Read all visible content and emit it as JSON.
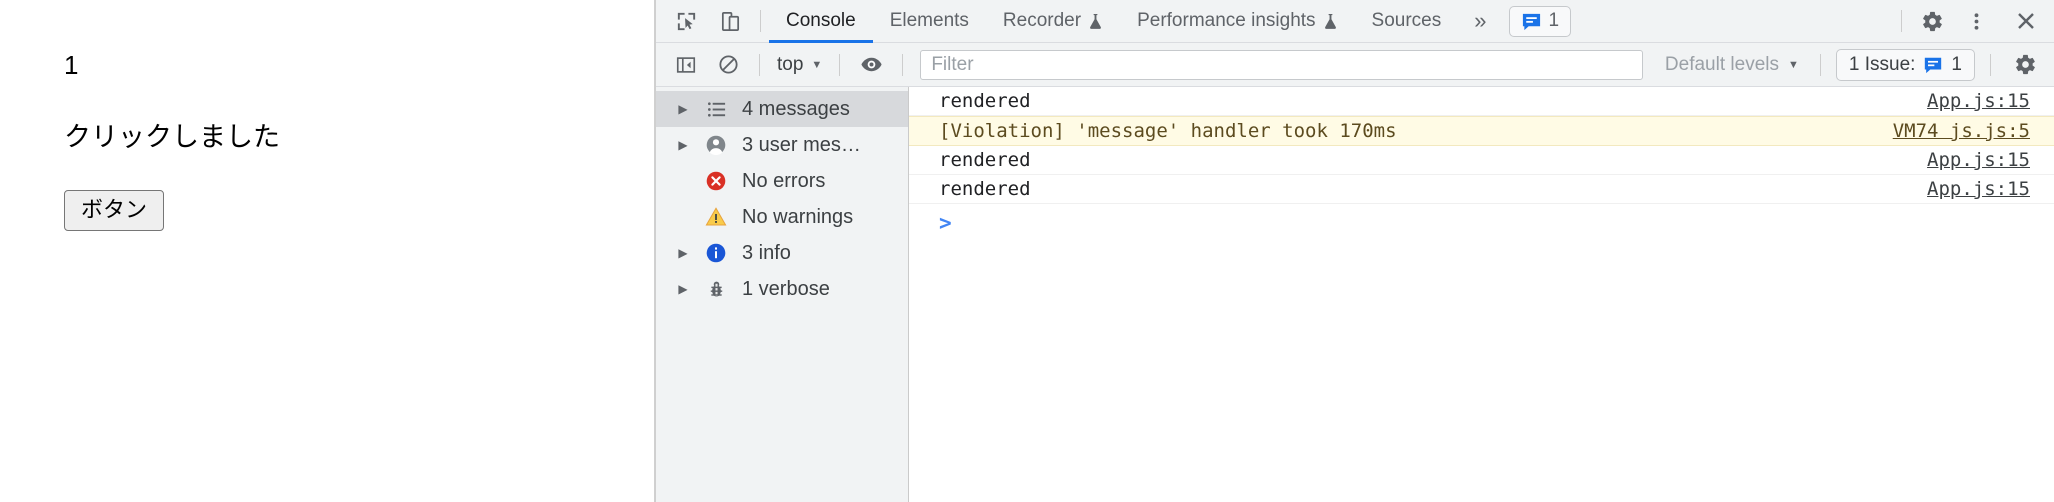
{
  "page": {
    "count_text": "1",
    "message_text": "クリックしました",
    "button_label": "ボタン"
  },
  "devtools": {
    "tabbar": {
      "inspect_icon": "inspect-cursor-icon",
      "device_toolbar_icon": "device-toolbar-icon",
      "tabs": [
        {
          "label": "Console",
          "experimental": false,
          "active": true
        },
        {
          "label": "Elements",
          "experimental": false,
          "active": false
        },
        {
          "label": "Recorder",
          "experimental": true,
          "active": false
        },
        {
          "label": "Performance insights",
          "experimental": true,
          "active": false
        },
        {
          "label": "Sources",
          "experimental": false,
          "active": false
        }
      ],
      "more_tabs_label": "»",
      "issues_badge": {
        "icon": "issue-bubble-icon",
        "count": "1"
      },
      "settings_icon": "gear-icon",
      "more_options_icon": "kebab-menu-icon",
      "close_icon": "close-icon"
    },
    "filterbar": {
      "sidebar_toggle_icon": "console-sidebar-toggle-icon",
      "clear_console_icon": "clear-console-icon",
      "context_label": "top",
      "context_caret": "▼",
      "live_expression_icon": "eye-icon",
      "filter_placeholder": "Filter",
      "filter_value": "",
      "levels_label": "Default levels",
      "levels_caret": "▼",
      "issue_chip": {
        "label": "1 Issue:",
        "icon": "issue-bubble-icon",
        "count": "1"
      },
      "settings_icon": "gear-icon"
    },
    "sidebar": {
      "items": [
        {
          "label": "4 messages",
          "icon": "list-icon",
          "twisty": true,
          "selected": true
        },
        {
          "label": "3 user mes…",
          "icon": "user-icon",
          "twisty": true,
          "selected": false
        },
        {
          "label": "No errors",
          "icon": "error-icon",
          "twisty": false,
          "selected": false
        },
        {
          "label": "No warnings",
          "icon": "warning-icon",
          "twisty": false,
          "selected": false
        },
        {
          "label": "3 info",
          "icon": "info-icon",
          "twisty": true,
          "selected": false
        },
        {
          "label": "1 verbose",
          "icon": "bug-icon",
          "twisty": true,
          "selected": false
        }
      ]
    },
    "console": {
      "messages": [
        {
          "text": "rendered",
          "source": "App.js:15",
          "level": "info"
        },
        {
          "text": "[Violation] 'message' handler took 170ms",
          "source": "VM74 js.js:5",
          "level": "violation"
        },
        {
          "text": "rendered",
          "source": "App.js:15",
          "level": "info"
        },
        {
          "text": "rendered",
          "source": "App.js:15",
          "level": "info"
        }
      ],
      "prompt_arrow": ">",
      "prompt_value": ""
    },
    "colors": {
      "accent": "#1a73e8",
      "violation_bg": "#fffbe5",
      "error": "#d93025",
      "warning": "#f9ab00",
      "info": "#1a73e8",
      "prompt": "#4285f4"
    }
  }
}
